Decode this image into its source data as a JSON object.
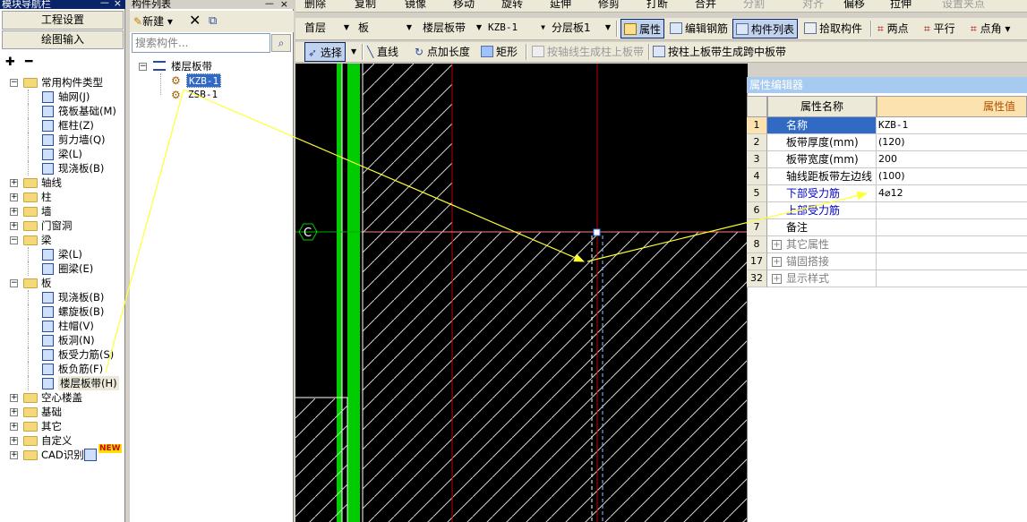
{
  "nav": {
    "title": "模块导航栏",
    "pin_glyph": "ᅳ",
    "close_glyph": "×",
    "buttons": [
      "工程设置",
      "绘图输入"
    ],
    "tree": [
      {
        "label": "常用构件类型",
        "level": 0,
        "type": "folder",
        "expanded": true
      },
      {
        "label": "轴网(J)",
        "level": 1,
        "type": "item",
        "icon": "grid-icon"
      },
      {
        "label": "筏板基础(M)",
        "level": 1,
        "type": "item",
        "icon": "raft-foundation-icon"
      },
      {
        "label": "框柱(Z)",
        "level": 1,
        "type": "item",
        "icon": "column-icon"
      },
      {
        "label": "剪力墙(Q)",
        "level": 1,
        "type": "item",
        "icon": "shear-wall-icon"
      },
      {
        "label": "梁(L)",
        "level": 1,
        "type": "item",
        "icon": "beam-icon"
      },
      {
        "label": "现浇板(B)",
        "level": 1,
        "type": "item",
        "icon": "slab-icon"
      },
      {
        "label": "轴线",
        "level": 0,
        "type": "folder",
        "expanded": false
      },
      {
        "label": "柱",
        "level": 0,
        "type": "folder",
        "expanded": false
      },
      {
        "label": "墙",
        "level": 0,
        "type": "folder",
        "expanded": false
      },
      {
        "label": "门窗洞",
        "level": 0,
        "type": "folder",
        "expanded": false
      },
      {
        "label": "梁",
        "level": 0,
        "type": "folder",
        "expanded": true
      },
      {
        "label": "梁(L)",
        "level": 1,
        "type": "item",
        "icon": "beam-icon"
      },
      {
        "label": "圈梁(E)",
        "level": 1,
        "type": "item",
        "icon": "ring-beam-icon"
      },
      {
        "label": "板",
        "level": 0,
        "type": "folder",
        "expanded": true
      },
      {
        "label": "现浇板(B)",
        "level": 1,
        "type": "item",
        "icon": "slab-icon"
      },
      {
        "label": "螺旋板(B)",
        "level": 1,
        "type": "item",
        "icon": "spiral-slab-icon"
      },
      {
        "label": "柱帽(V)",
        "level": 1,
        "type": "item",
        "icon": "column-cap-icon"
      },
      {
        "label": "板洞(N)",
        "level": 1,
        "type": "item",
        "icon": "slab-hole-icon"
      },
      {
        "label": "板受力筋(S)",
        "level": 1,
        "type": "item",
        "icon": "slab-rebar-icon"
      },
      {
        "label": "板负筋(F)",
        "level": 1,
        "type": "item",
        "icon": "negative-rebar-icon"
      },
      {
        "label": "楼层板带(H)",
        "level": 1,
        "type": "item",
        "icon": "floor-strip-icon",
        "selected": true
      },
      {
        "label": "空心楼盖",
        "level": 0,
        "type": "folder",
        "expanded": false
      },
      {
        "label": "基础",
        "level": 0,
        "type": "folder",
        "expanded": false
      },
      {
        "label": "其它",
        "level": 0,
        "type": "folder",
        "expanded": false
      },
      {
        "label": "自定义",
        "level": 0,
        "type": "folder",
        "expanded": false
      },
      {
        "label": "CAD识别",
        "level": 0,
        "type": "folder",
        "expanded": false,
        "badge": "NEW"
      }
    ]
  },
  "comp": {
    "title": "构件列表",
    "pin_glyph": "ᅳ",
    "close_glyph": "×",
    "new_label": "新建",
    "search_placeholder": "搜索构件...",
    "root_label": "楼层板带",
    "items": [
      "KZB-1",
      "ZSB-1"
    ]
  },
  "toolbar1": [
    "删除",
    "复制",
    "镜像",
    "移动",
    "旋转",
    "延伸",
    "修剪",
    "打断",
    "合并",
    "分割",
    "对齐",
    "偏移",
    "拉伸",
    "设置夹点"
  ],
  "toolbar2": {
    "floor": "首层",
    "category": "板",
    "type": "楼层板带",
    "component": "KZB-1",
    "layer": "分层板1",
    "buttons": [
      "属性",
      "编辑钢筋",
      "构件列表",
      "拾取构件",
      "两点",
      "平行",
      "点角"
    ]
  },
  "toolbar3": {
    "select": "选择",
    "buttons": [
      "直线",
      "点加长度",
      "矩形",
      "按轴线生成柱上板带",
      "按柱上板带生成跨中板带"
    ]
  },
  "canvas": {
    "axis_label": "C"
  },
  "props": {
    "title": "属性编辑器",
    "col_name": "属性名称",
    "col_value": "属性值",
    "rows": [
      {
        "num": "1",
        "name": "名称",
        "value": "KZB-1",
        "selected": true
      },
      {
        "num": "2",
        "name": "板带厚度(mm)",
        "value": "(120)"
      },
      {
        "num": "3",
        "name": "板带宽度(mm)",
        "value": "200"
      },
      {
        "num": "4",
        "name": "轴线距板带左边线",
        "value": "(100)"
      },
      {
        "num": "5",
        "name": "下部受力筋",
        "value": "4⌀12",
        "highlight": true
      },
      {
        "num": "6",
        "name": "上部受力筋",
        "value": "",
        "highlight": true
      },
      {
        "num": "7",
        "name": "备注",
        "value": ""
      },
      {
        "num": "8",
        "name": "其它属性",
        "value": "",
        "group": true
      },
      {
        "num": "17",
        "name": "锚固搭接",
        "value": "",
        "group": true
      },
      {
        "num": "32",
        "name": "显示样式",
        "value": "",
        "group": true
      }
    ]
  },
  "colors": {
    "annotation_arrow": "#ffff33",
    "wall_green": "#00cc00",
    "grid_red": "#c00000",
    "selection_blue": "#316ac5"
  }
}
